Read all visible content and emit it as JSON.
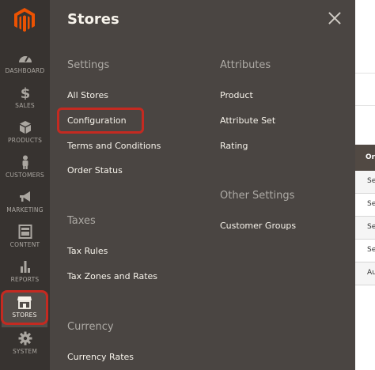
{
  "sidebar": {
    "items": [
      {
        "label": "DASHBOARD",
        "icon": "gauge-icon"
      },
      {
        "label": "SALES",
        "icon": "dollar-icon"
      },
      {
        "label": "PRODUCTS",
        "icon": "cube-icon"
      },
      {
        "label": "CUSTOMERS",
        "icon": "person-icon"
      },
      {
        "label": "MARKETING",
        "icon": "megaphone-icon"
      },
      {
        "label": "CONTENT",
        "icon": "layout-icon"
      },
      {
        "label": "REPORTS",
        "icon": "bar-chart-icon"
      },
      {
        "label": "STORES",
        "icon": "storefront-icon",
        "active": true
      },
      {
        "label": "SYSTEM",
        "icon": "gear-icon"
      }
    ]
  },
  "panel": {
    "title": "Stores",
    "sections": {
      "settings": {
        "title": "Settings",
        "links": [
          "All Stores",
          "Configuration",
          "Terms and Conditions",
          "Order Status"
        ]
      },
      "taxes": {
        "title": "Taxes",
        "links": [
          "Tax Rules",
          "Tax Zones and Rates"
        ]
      },
      "currency": {
        "title": "Currency",
        "links": [
          "Currency Rates"
        ]
      },
      "attributes": {
        "title": "Attributes",
        "links": [
          "Product",
          "Attribute Set",
          "Rating"
        ]
      },
      "other_settings": {
        "title": "Other Settings",
        "links": [
          "Customer Groups"
        ]
      }
    }
  },
  "background_table": {
    "header": "Or",
    "cells": [
      "Se",
      "Se",
      "Se",
      "Se",
      "Au"
    ]
  },
  "colors": {
    "sidebar_bg": "#373330",
    "panel_bg": "#4a4542",
    "highlight": "#c42a21",
    "logo": "#eb5202"
  }
}
